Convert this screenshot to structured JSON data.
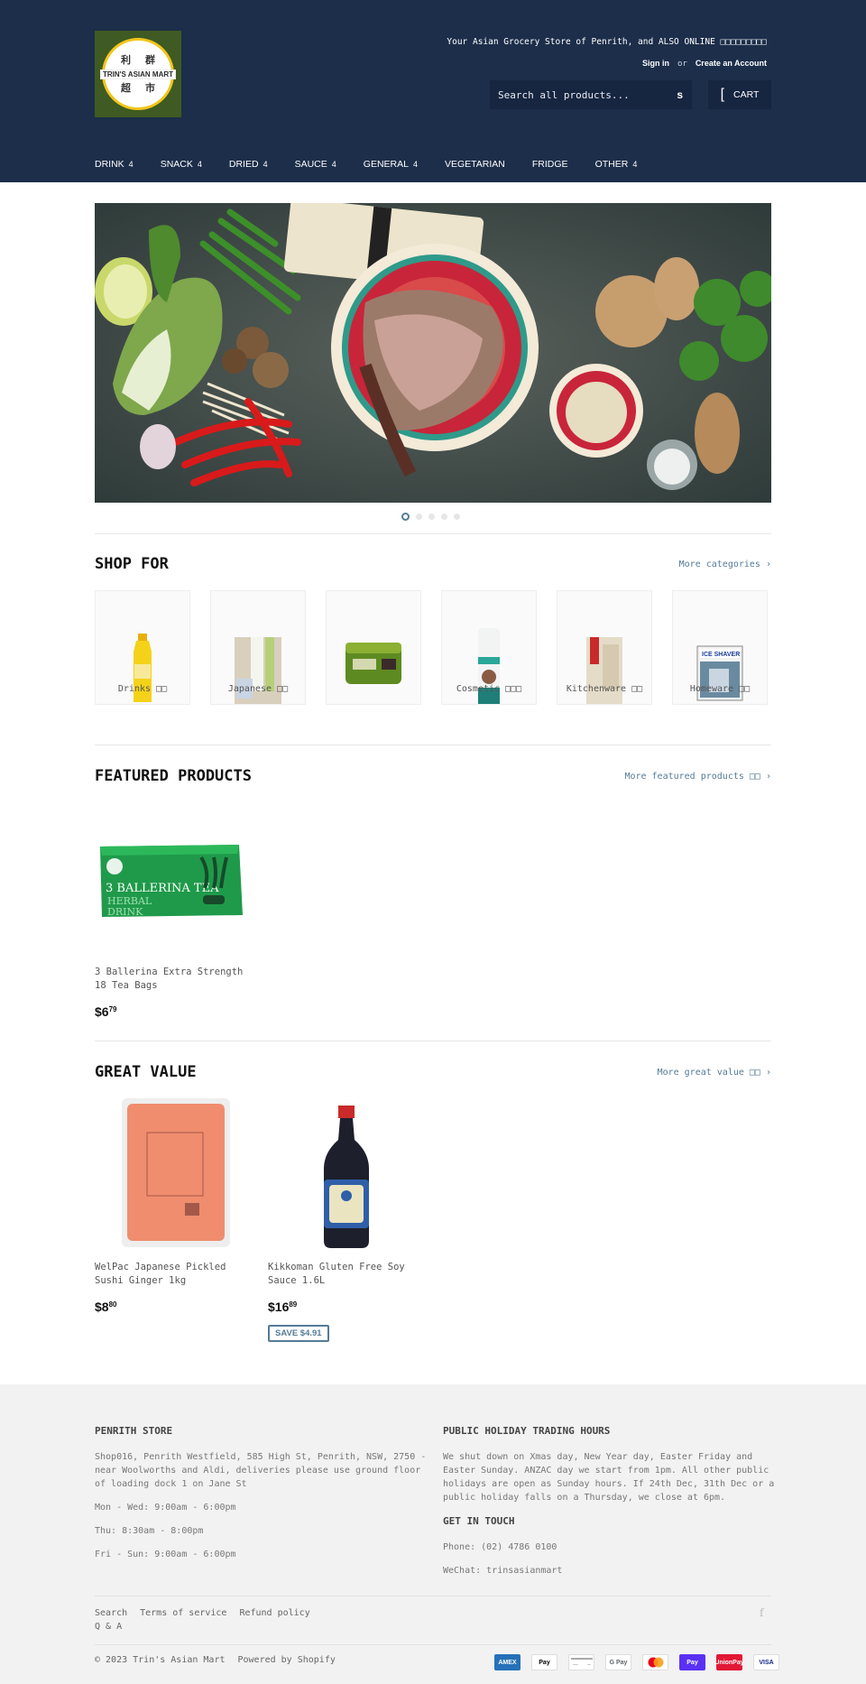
{
  "header": {
    "logo": {
      "cjk_top": [
        "利",
        "群"
      ],
      "cjk_bottom": [
        "超",
        "市"
      ],
      "name": "TRIN'S ASIAN MART"
    },
    "tagline": "Your Asian Grocery Store of Penrith, and ALSO ONLINE □□□□□□□□□",
    "sign_in": "Sign in",
    "or": "or",
    "create_account": "Create an Account",
    "search": {
      "placeholder": "Search all products...",
      "icon": "search-icon",
      "icon_glyph": "s"
    },
    "cart": {
      "icon_glyph": "[",
      "label": "CART"
    },
    "nav": [
      {
        "label": "DRINK",
        "has_dropdown": true
      },
      {
        "label": "SNACK",
        "has_dropdown": true
      },
      {
        "label": "DRIED",
        "has_dropdown": true
      },
      {
        "label": "SAUCE",
        "has_dropdown": true
      },
      {
        "label": "GENERAL",
        "has_dropdown": true
      },
      {
        "label": "VEGETARIAN",
        "has_dropdown": false
      },
      {
        "label": "FRIDGE",
        "has_dropdown": false
      },
      {
        "label": "OTHER",
        "has_dropdown": true
      }
    ],
    "dropdown_glyph": "4"
  },
  "hero": {
    "alt": "Asian cooking ingredients: bok choy, chilli, shrimp, noodles, ginger",
    "slide_count": 5,
    "active_slide": 1
  },
  "shop_for": {
    "title": "SHOP FOR",
    "more_link": "More categories ›",
    "categories": [
      {
        "label": "Drinks □□"
      },
      {
        "label": "Japanese □□"
      },
      {
        "label": ""
      },
      {
        "label": "Cosmetic □□□"
      },
      {
        "label": "Kitchenware □□"
      },
      {
        "label": "Homeware □□"
      }
    ]
  },
  "featured": {
    "title": "FEATURED PRODUCTS",
    "more_link": "More featured products □□ ›",
    "products": [
      {
        "title": "3 Ballerina Extra Strength 18 Tea Bags",
        "price_dollars": "$6",
        "price_cents": "79"
      }
    ]
  },
  "great_value": {
    "title": "GREAT VALUE",
    "more_link": "More great value □□ ›",
    "products": [
      {
        "title": "WelPac Japanese Pickled Sushi Ginger 1kg",
        "price_dollars": "$8",
        "price_cents": "80",
        "badge": ""
      },
      {
        "title": "Kikkoman Gluten Free Soy Sauce 1.6L",
        "price_dollars": "$16",
        "price_cents": "89",
        "badge": "SAVE $4.91"
      }
    ]
  },
  "footer": {
    "store": {
      "title": "PENRITH STORE",
      "address": "Shop016, Penrith Westfield, 585 High St, Penrith, NSW, 2750 - near Woolworths and Aldi, deliveries please use ground floor of loading dock 1 on Jane St",
      "hours": [
        "Mon - Wed: 9:00am - 6:00pm",
        "Thu: 8:30am - 8:00pm",
        "Fri - Sun: 9:00am - 6:00pm"
      ]
    },
    "holiday": {
      "title": "PUBLIC HOLIDAY TRADING HOURS",
      "text": "We shut down on Xmas day, New Year day, Easter Friday and Easter Sunday. ANZAC day we start from 1pm. All other public holidays are open as Sunday hours. If 24th Dec, 31th Dec or a public holiday falls on a Thursday, we close at 6pm."
    },
    "contact": {
      "title": "GET IN TOUCH",
      "phone": "Phone: (02) 4786 0100",
      "wechat": "WeChat: trinsasianmart"
    },
    "links": [
      "Search",
      "Terms of service",
      "Refund policy",
      "Q & A"
    ],
    "social_glyph": "f",
    "copyright": "© 2023 Trin's Asian Mart",
    "powered_by": "Powered by Shopify",
    "payments": [
      {
        "name": "amex",
        "label": "AMEX",
        "color": "#2671b9",
        "text_color": "#ffffff"
      },
      {
        "name": "apple-pay",
        "label": "Pay",
        "color": "#ffffff",
        "text_color": "#000000"
      },
      {
        "name": "generic-card",
        "label": "",
        "color": "#ffffff",
        "text_color": "#999999"
      },
      {
        "name": "google-pay",
        "label": "G Pay",
        "color": "#ffffff",
        "text_color": "#5f6368"
      },
      {
        "name": "mastercard",
        "label": "",
        "color": "#ffffff",
        "text_color": "#000000"
      },
      {
        "name": "shop-pay",
        "label": "Pay",
        "color": "#5a31f4",
        "text_color": "#ffffff"
      },
      {
        "name": "unionpay",
        "label": "UnionPay",
        "color": "#e21836",
        "text_color": "#ffffff"
      },
      {
        "name": "visa",
        "label": "VISA",
        "color": "#ffffff",
        "text_color": "#142688"
      }
    ]
  },
  "colors": {
    "header_bg": "#1c2e4a",
    "accent": "#557b97",
    "footer_bg": "#f2f2f2",
    "logo_green": "#3f5a22",
    "logo_yellow": "#f2c51a"
  }
}
